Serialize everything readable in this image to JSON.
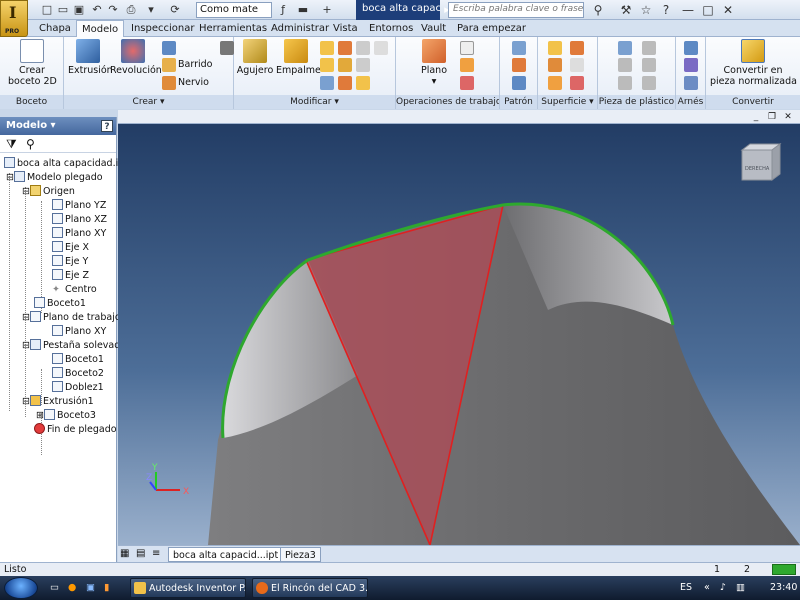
{
  "titlebar": {
    "material": "Como mate",
    "document_title": "boca alta capaci...",
    "search_placeholder": "Escriba palabra clave o frase"
  },
  "app_button": {
    "label": "PRO"
  },
  "tabs": [
    {
      "label": "Chapa"
    },
    {
      "label": "Modelo"
    },
    {
      "label": "Inspeccionar"
    },
    {
      "label": "Herramientas"
    },
    {
      "label": "Administrar"
    },
    {
      "label": "Vista"
    },
    {
      "label": "Entornos"
    },
    {
      "label": "Vault"
    },
    {
      "label": "Para empezar"
    }
  ],
  "ribbon": {
    "boceto": {
      "title": "Boceto",
      "create_sketch": "Crear",
      "create_sketch_2": "boceto 2D"
    },
    "crear": {
      "title": "Crear",
      "extrusion": "Extrusión",
      "revolucion": "Revolución",
      "barrido": "Barrido",
      "nervio": "Nervio"
    },
    "modificar": {
      "title": "Modificar",
      "agujero": "Agujero",
      "empalme": "Empalme"
    },
    "operaciones": {
      "title": "Operaciones de trabajo",
      "plano": "Plano"
    },
    "patron": {
      "title": "Patrón"
    },
    "superficie": {
      "title": "Superficie"
    },
    "plastico": {
      "title": "Pieza de plástico"
    },
    "arnes": {
      "title": "Arnés"
    },
    "convertir": {
      "title": "Convertir",
      "line1": "Convertir en",
      "line2": "pieza normalizada"
    }
  },
  "browser": {
    "title": "Modelo",
    "help": "?",
    "tree": [
      {
        "label": "boca alta capacidad.ipt"
      },
      {
        "label": "Modelo plegado"
      },
      {
        "label": "Origen"
      },
      {
        "label": "Plano YZ"
      },
      {
        "label": "Plano XZ"
      },
      {
        "label": "Plano XY"
      },
      {
        "label": "Eje X"
      },
      {
        "label": "Eje Y"
      },
      {
        "label": "Eje Z"
      },
      {
        "label": "Centro"
      },
      {
        "label": "Boceto1"
      },
      {
        "label": "Plano de trabajo"
      },
      {
        "label": "Plano XY"
      },
      {
        "label": "Pestaña solevada"
      },
      {
        "label": "Boceto1"
      },
      {
        "label": "Boceto2"
      },
      {
        "label": "Doblez1"
      },
      {
        "label": "Extrusión1"
      },
      {
        "label": "Boceto3"
      },
      {
        "label": "Fin de plegado"
      }
    ]
  },
  "viewcube": {
    "label": "DERECHA"
  },
  "axes": {
    "x": "X",
    "y": "Y",
    "z": "Z"
  },
  "doc_tabs": [
    {
      "label": "boca alta capacid...ipt"
    },
    {
      "label": "Pieza3"
    }
  ],
  "statusbar": {
    "status": "Listo",
    "count1": "1",
    "count2": "2"
  },
  "taskbar": {
    "tasks": [
      {
        "label": "Autodesk Inventor P..."
      },
      {
        "label": "El Rincón del CAD 3..."
      }
    ],
    "language": "ES",
    "time": "23:40"
  },
  "colors": {
    "viewport_top": "#203a62",
    "viewport_bottom": "#9ab0cc",
    "edge_green": "#2ea82e",
    "plane_red": "#cc2222",
    "title_blue": "#1d3e7a"
  }
}
